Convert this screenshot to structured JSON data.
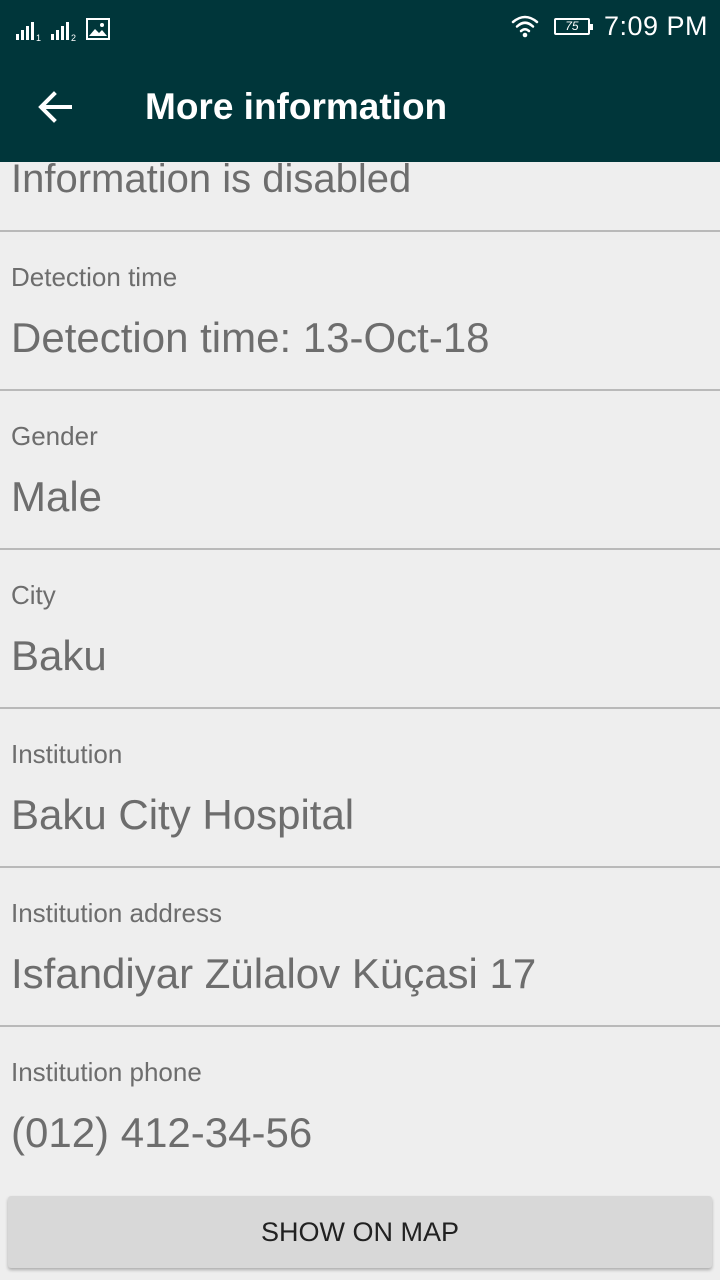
{
  "status_bar": {
    "sim1_label": "1",
    "sim2_label": "2",
    "battery_level": "75",
    "time": "7:09 PM",
    "icons": [
      "signal-sim1-icon",
      "signal-sim2-icon",
      "image-icon",
      "wifi-icon",
      "battery-icon"
    ]
  },
  "app_bar": {
    "title": "More information",
    "back_icon": "arrow-left-icon",
    "background": "#00363a"
  },
  "details": {
    "partial_value": "Information is disabled",
    "fields": [
      {
        "label": "Detection time",
        "value": "Detection time: 13-Oct-18"
      },
      {
        "label": "Gender",
        "value": "Male"
      },
      {
        "label": "City",
        "value": "Baku"
      },
      {
        "label": "Institution",
        "value": "Baku City Hospital"
      },
      {
        "label": "Institution address",
        "value": "Isfandiyar Zülalov Küçasi 17"
      },
      {
        "label": "Institution phone",
        "value": "(012) 412-34-56"
      }
    ]
  },
  "actions": {
    "show_on_map_label": "SHOW ON MAP"
  }
}
